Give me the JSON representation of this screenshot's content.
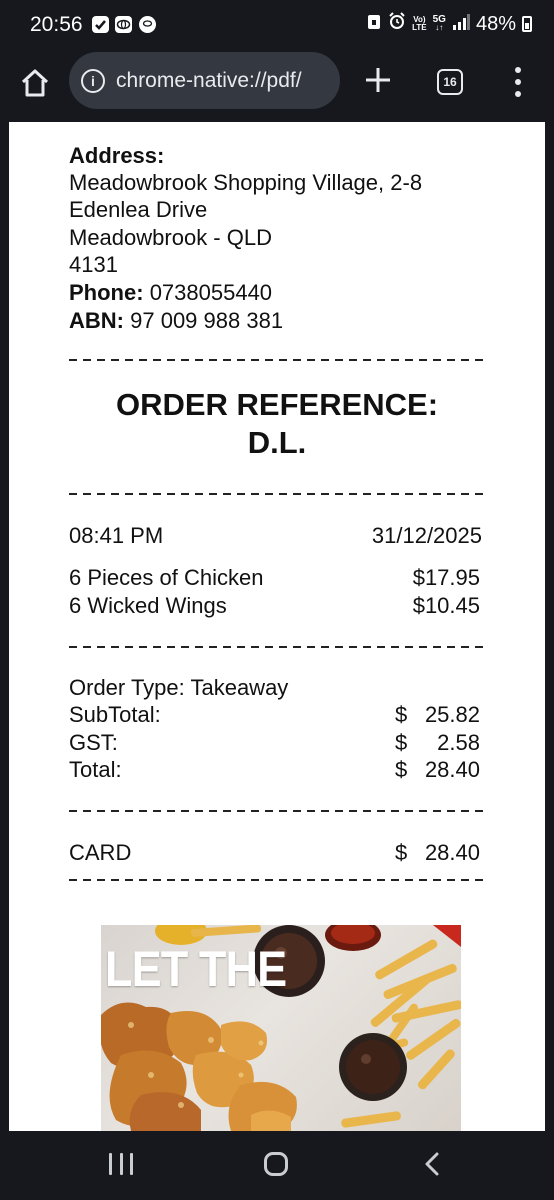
{
  "status_bar": {
    "time": "20:56",
    "battery": "48%",
    "network": "5G",
    "lte_top": "Vo)",
    "lte_bottom": "LTE"
  },
  "browser": {
    "url": "chrome-native://pdf/",
    "tab_count": "16"
  },
  "receipt": {
    "address_label": "Address:",
    "address_line1": "Meadowbrook Shopping Village, 2-8",
    "address_line2": "Edenlea Drive",
    "address_line3": "Meadowbrook - QLD",
    "address_line4": "4131",
    "phone_label": "Phone:",
    "phone_value": "0738055440",
    "abn_label": "ABN:",
    "abn_value": "97 009 988 381",
    "order_ref_line1": "ORDER REFERENCE:",
    "order_ref_line2": "D.L.",
    "time": "08:41 PM",
    "date": "31/12/2025",
    "items": [
      {
        "name": "6 Pieces of Chicken",
        "price": "$17.95"
      },
      {
        "name": "6 Wicked Wings",
        "price": "$10.45"
      }
    ],
    "order_type": "Order Type: Takeaway",
    "subtotal_label": "SubTotal:",
    "subtotal_currency": "$",
    "subtotal_value": "25.82",
    "gst_label": "GST:",
    "gst_currency": "$",
    "gst_value": "2.58",
    "total_label": "Total:",
    "total_currency": "$",
    "total_value": "28.40",
    "payment_method": "CARD",
    "payment_currency": "$",
    "payment_value": "28.40"
  },
  "promo": {
    "headline": "LET THE"
  },
  "colors": {
    "system_bar": "#16181d",
    "url_bar": "#333841",
    "page": "#ffffff"
  }
}
